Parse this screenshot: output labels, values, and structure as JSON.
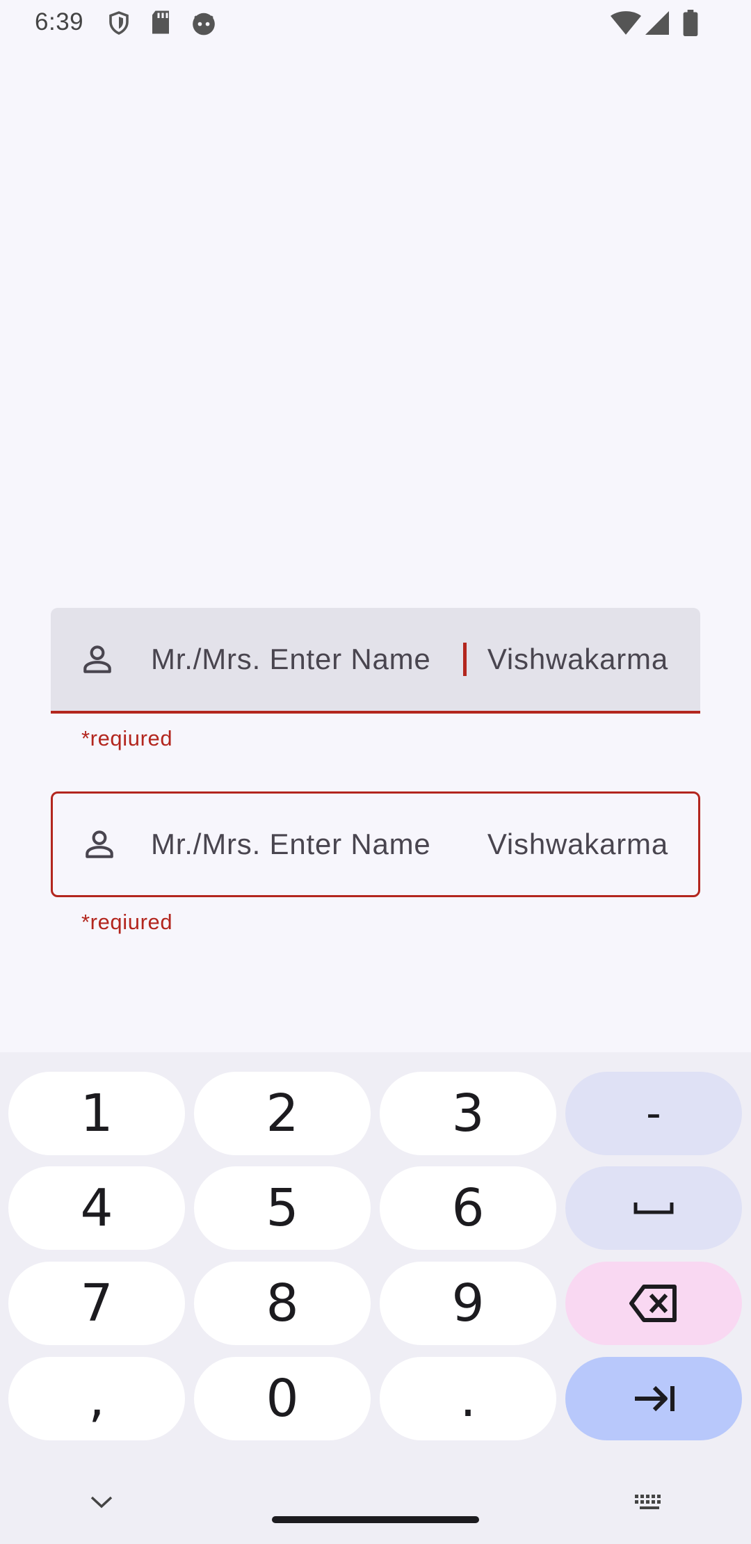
{
  "status_bar": {
    "time": "6:39",
    "left_icons": [
      "shield-icon",
      "sd-card-icon",
      "android-face-icon"
    ],
    "right_icons": [
      "wifi-icon",
      "cellular-icon",
      "battery-icon"
    ]
  },
  "fields": [
    {
      "variant": "filled",
      "icon": "person-icon",
      "prefix": "Mr./Mrs. Enter Name",
      "suffix": "Vishwakarma",
      "helper": "*reqiured",
      "focused": true
    },
    {
      "variant": "outlined",
      "icon": "person-icon",
      "prefix": "Mr./Mrs. Enter Name",
      "suffix": "Vishwakarma",
      "helper": "*reqiured",
      "focused": false
    }
  ],
  "keyboard": {
    "rows": [
      [
        "1",
        "2",
        "3",
        "-"
      ],
      [
        "4",
        "5",
        "6",
        "space-icon"
      ],
      [
        "7",
        "8",
        "9",
        "backspace-icon"
      ],
      [
        ",",
        "0",
        ".",
        "tab-icon"
      ]
    ],
    "bottom_icons": [
      "chevron-down-icon",
      "keyboard-icon"
    ]
  },
  "colors": {
    "error": "#b3261e",
    "background": "#f7f6fc",
    "filled_field": "#e3e2ea",
    "keyboard_bg": "#efeef5",
    "key_func": "#dfe1f5",
    "key_delete": "#f9d8f2",
    "key_enter": "#b8c8fb"
  }
}
